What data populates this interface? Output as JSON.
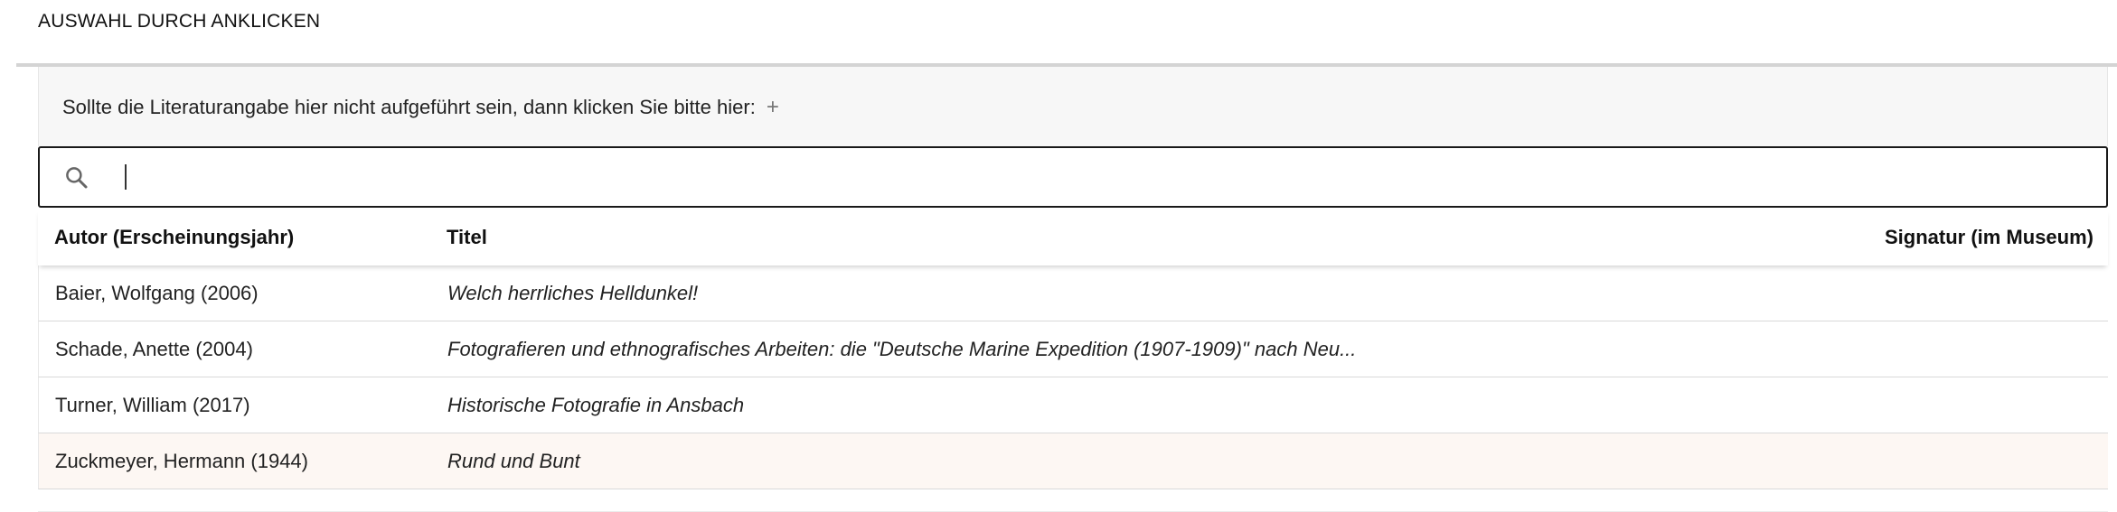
{
  "section": {
    "title": "AUSWAHL DURCH ANKLICKEN"
  },
  "notice": {
    "text": "Sollte die Literaturangabe hier nicht aufgeführt sein, dann klicken Sie bitte hier:",
    "add_label": "+"
  },
  "search": {
    "value": "",
    "placeholder": "",
    "icon": "search-icon"
  },
  "table": {
    "headers": {
      "author": "Autor (Erscheinungsjahr)",
      "title": "Titel",
      "signature": "Signatur (im Museum)"
    },
    "rows": [
      {
        "author": "Baier, Wolfgang (2006)",
        "title": "Welch herrliches Helldunkel!",
        "signature": ""
      },
      {
        "author": "Schade, Anette (2004)",
        "title": "Fotografieren und ethnografisches Arbeiten: die \"Deutsche Marine Expedition (1907-1909)\" nach Neu...",
        "signature": ""
      },
      {
        "author": "Turner, William (2017)",
        "title": "Historische Fotografie in Ansbach",
        "signature": ""
      },
      {
        "author": "Zuckmeyer, Hermann (1944)",
        "title": "Rund und Bunt",
        "signature": ""
      }
    ]
  },
  "colors": {
    "panel_bg": "#f7f7f7",
    "highlight_row": "#fdf7f3",
    "border": "#1a1a1a"
  }
}
